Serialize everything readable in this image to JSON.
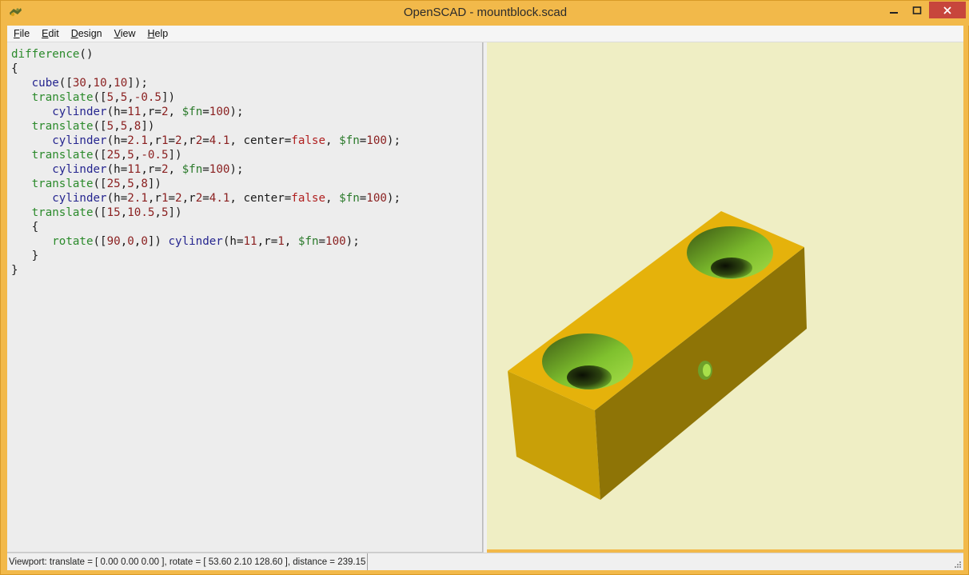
{
  "window": {
    "title": "OpenSCAD - mountblock.scad",
    "buttons": {
      "minimize": "minimize",
      "maximize": "maximize",
      "close": "close"
    }
  },
  "menu": [
    {
      "label_u": "F",
      "label_rest": "ile"
    },
    {
      "label_u": "E",
      "label_rest": "dit"
    },
    {
      "label_u": "D",
      "label_rest": "esign"
    },
    {
      "label_u": "V",
      "label_rest": "iew"
    },
    {
      "label_u": "H",
      "label_rest": "elp"
    }
  ],
  "editor": {
    "lines": [
      "difference()",
      "{",
      "   cube([30,10,10]);",
      "   translate([5,5,-0.5])",
      "      cylinder(h=11,r=2, $fn=100);",
      "   translate([5,5,8])",
      "      cylinder(h=2.1,r1=2,r2=4.1, center=false, $fn=100);",
      "   translate([25,5,-0.5])",
      "      cylinder(h=11,r=2, $fn=100);",
      "   translate([25,5,8])",
      "      cylinder(h=2.1,r1=2,r2=4.1, center=false, $fn=100);",
      "   translate([15,10.5,5])",
      "   {",
      "      rotate([90,0,0]) cylinder(h=11,r=1, $fn=100);",
      "   }",
      "}"
    ]
  },
  "status": {
    "viewport_text": "Viewport: translate = [ 0.00 0.00 0.00 ], rotate = [ 53.60 2.10 128.60 ], distance = 239.15"
  },
  "colors": {
    "viewport_bg": "#efeec4",
    "block_top": "#e5b20b",
    "block_front": "#c9a008",
    "block_side": "#8e7406",
    "hole_green": "#7fc12e",
    "title_bar": "#f2b94a",
    "close_button": "#c7463c"
  },
  "icons": {
    "app": "openscad-app-icon",
    "grip": "resize-grip-icon"
  }
}
